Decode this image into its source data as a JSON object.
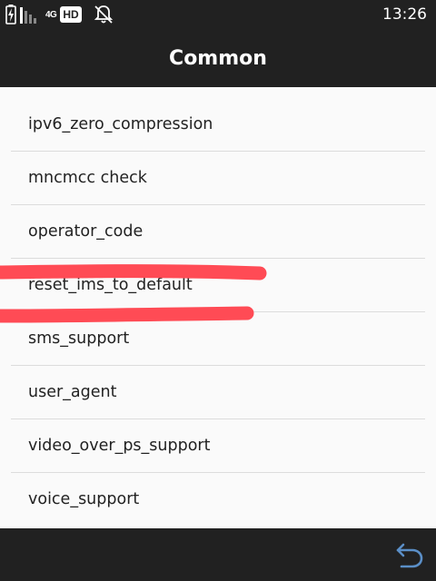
{
  "status_bar": {
    "network_label": "4G",
    "hd_label": "HD",
    "time": "13:26",
    "icons": [
      "battery-charging-icon",
      "signal-icon",
      "notifications-off-icon"
    ]
  },
  "app_bar": {
    "title": "Common"
  },
  "list": {
    "items": [
      {
        "label": "ipv6_zero_compression"
      },
      {
        "label": "mncmcc check"
      },
      {
        "label": "operator_code"
      },
      {
        "label": "reset_ims_to_default"
      },
      {
        "label": "sms_support"
      },
      {
        "label": "user_agent"
      },
      {
        "label": "video_over_ps_support"
      },
      {
        "label": "voice_support"
      }
    ]
  },
  "annotation": {
    "color": "#ff4b55"
  },
  "nav_bar": {
    "icons": [
      "back-icon"
    ]
  }
}
